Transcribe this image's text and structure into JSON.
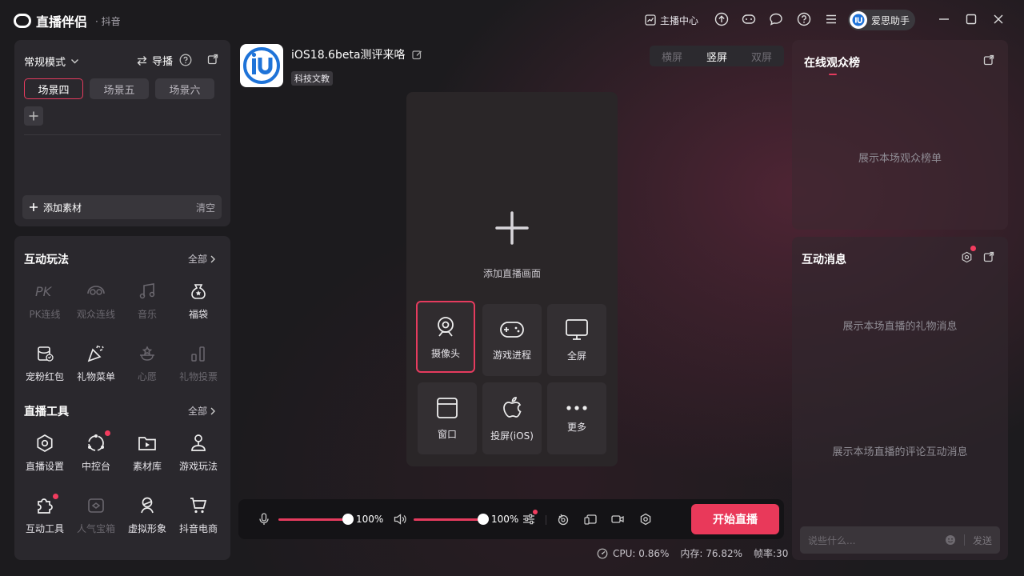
{
  "app": {
    "name": "直播伴侣",
    "platform": "· 抖音"
  },
  "titlebar": {
    "anchor_center": "主播中心",
    "user_name": "爱思助手"
  },
  "scene_panel": {
    "mode": "常规模式",
    "guide": "导播",
    "tabs": [
      {
        "label": "场景四"
      },
      {
        "label": "场景五"
      },
      {
        "label": "场景六"
      }
    ],
    "add_material": "添加素材",
    "clear": "清空"
  },
  "interactive": {
    "title": "互动玩法",
    "all": "全部",
    "items": [
      {
        "label": "PK连线",
        "icon": "pk-icon"
      },
      {
        "label": "观众连线",
        "icon": "audience-link-icon"
      },
      {
        "label": "音乐",
        "icon": "music-icon"
      },
      {
        "label": "福袋",
        "icon": "lucky-bag-icon"
      },
      {
        "label": "宠粉红包",
        "icon": "red-packet-icon"
      },
      {
        "label": "礼物菜单",
        "icon": "gift-menu-icon"
      },
      {
        "label": "心愿",
        "icon": "wish-icon"
      },
      {
        "label": "礼物投票",
        "icon": "gift-vote-icon"
      }
    ]
  },
  "live_tools": {
    "title": "直播工具",
    "all": "全部",
    "items": [
      {
        "label": "直播设置",
        "icon": "live-settings-icon"
      },
      {
        "label": "中控台",
        "icon": "control-center-icon"
      },
      {
        "label": "素材库",
        "icon": "material-library-icon"
      },
      {
        "label": "游戏玩法",
        "icon": "game-play-icon"
      },
      {
        "label": "互动工具",
        "icon": "interactive-tools-icon"
      },
      {
        "label": "人气宝箱",
        "icon": "treasure-box-icon"
      },
      {
        "label": "虚拟形象",
        "icon": "avatar-icon"
      },
      {
        "label": "抖音电商",
        "icon": "shopping-cart-icon"
      }
    ]
  },
  "room": {
    "title": "iOS18.6beta测评来咯",
    "tag": "科技文教"
  },
  "orientation": {
    "options": [
      "横屏",
      "竖屏",
      "双屏"
    ],
    "selected": "竖屏"
  },
  "stage": {
    "hint": "添加直播画面",
    "sources": [
      {
        "label": "摄像头",
        "icon": "camera-icon"
      },
      {
        "label": "游戏进程",
        "icon": "gamepad-icon"
      },
      {
        "label": "全屏",
        "icon": "monitor-icon"
      },
      {
        "label": "窗口",
        "icon": "window-icon"
      },
      {
        "label": "投屏(iOS)",
        "icon": "apple-icon"
      },
      {
        "label": "更多",
        "icon": "more-icon"
      }
    ]
  },
  "audio": {
    "mic_level": 1.0,
    "mic_pct": "100%",
    "speaker_level": 1.0,
    "speaker_pct": "100%"
  },
  "start_button": "开始直播",
  "stats": {
    "cpu": "CPU: 0.86%",
    "memory": "内存: 76.82%",
    "fps": "帧率:30"
  },
  "rank_panel": {
    "title": "在线观众榜",
    "placeholder": "展示本场观众榜单"
  },
  "msg_panel": {
    "title": "互动消息",
    "gift_placeholder": "展示本场直播的礼物消息",
    "comment_placeholder": "展示本场直播的评论互动消息",
    "input_placeholder": "说些什么...",
    "send": "发送"
  },
  "colors": {
    "accent": "#e53b5e",
    "start": "#e9395a"
  }
}
